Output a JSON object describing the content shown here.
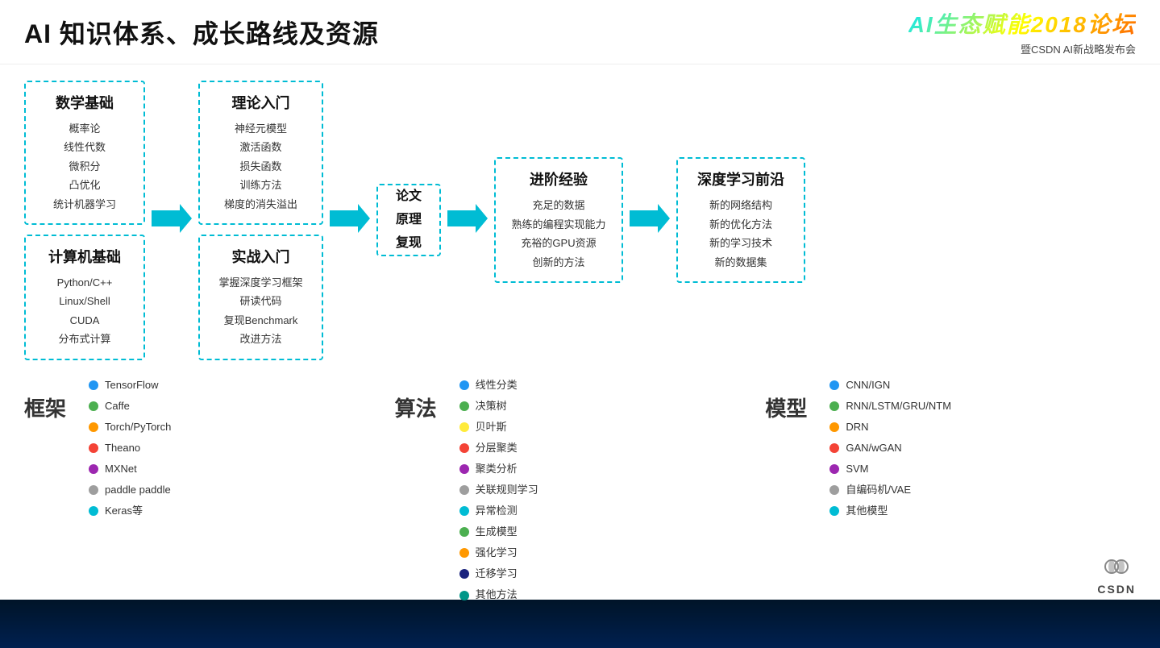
{
  "header": {
    "title": "AI 知识体系、成长路线及资源",
    "logo_main": "AI生态赋能2018论坛",
    "logo_sub": "暨CSDN AI新战略发布会"
  },
  "flow_boxes": {
    "math_title": "数学基础",
    "math_items": [
      "概率论",
      "线性代数",
      "微积分",
      "凸优化",
      "统计机器学习"
    ],
    "cs_title": "计算机基础",
    "cs_items": [
      "Python/C++",
      "Linux/Shell",
      "CUDA",
      "分布式计算"
    ],
    "theory_title": "理论入门",
    "theory_items": [
      "神经元模型",
      "激活函数",
      "损失函数",
      "训练方法",
      "梯度的消失溢出"
    ],
    "practice_title": "实战入门",
    "practice_items": [
      "掌握深度学习框架",
      "研读代码",
      "复现Benchmark",
      "改进方法"
    ],
    "paper_lines": [
      "论文",
      "原理",
      "复现"
    ],
    "advanced_title": "进阶经验",
    "advanced_items": [
      "充足的数据",
      "熟练的编程实现能力",
      "充裕的GPU资源",
      "创新的方法"
    ],
    "frontier_title": "深度学习前沿",
    "frontier_items": [
      "新的网络结构",
      "新的优化方法",
      "新的学习技术",
      "新的数据集"
    ]
  },
  "framework": {
    "label": "框架",
    "items": [
      {
        "color": "#2196F3",
        "name": "TensorFlow"
      },
      {
        "color": "#4CAF50",
        "name": "Caffe"
      },
      {
        "color": "#FF9800",
        "name": "Torch/PyTorch"
      },
      {
        "color": "#F44336",
        "name": "Theano"
      },
      {
        "color": "#9C27B0",
        "name": "MXNet"
      },
      {
        "color": "#9E9E9E",
        "name": "paddle paddle"
      },
      {
        "color": "#00BCD4",
        "name": "Keras等"
      }
    ]
  },
  "algorithm": {
    "label": "算法",
    "items": [
      {
        "color": "#2196F3",
        "name": "线性分类"
      },
      {
        "color": "#4CAF50",
        "name": "决策树"
      },
      {
        "color": "#FFEB3B",
        "name": "贝叶斯"
      },
      {
        "color": "#F44336",
        "name": "分层聚类"
      },
      {
        "color": "#9C27B0",
        "name": "聚类分析"
      },
      {
        "color": "#9E9E9E",
        "name": "关联规则学习"
      },
      {
        "color": "#00BCD4",
        "name": "异常检测"
      },
      {
        "color": "#4CAF50",
        "name": "生成模型"
      },
      {
        "color": "#FF9800",
        "name": "强化学习"
      },
      {
        "color": "#1A237E",
        "name": "迁移学习"
      },
      {
        "color": "#009688",
        "name": "其他方法"
      }
    ]
  },
  "model": {
    "label": "模型",
    "items": [
      {
        "color": "#2196F3",
        "name": "CNN/IGN"
      },
      {
        "color": "#4CAF50",
        "name": "RNN/LSTM/GRU/NTM"
      },
      {
        "color": "#FF9800",
        "name": "DRN"
      },
      {
        "color": "#F44336",
        "name": "GAN/wGAN"
      },
      {
        "color": "#9C27B0",
        "name": "SVM"
      },
      {
        "color": "#9E9E9E",
        "name": "自编码机/VAE"
      },
      {
        "color": "#00BCD4",
        "name": "其他模型"
      }
    ]
  },
  "csdn": {
    "text": "CSDN"
  }
}
